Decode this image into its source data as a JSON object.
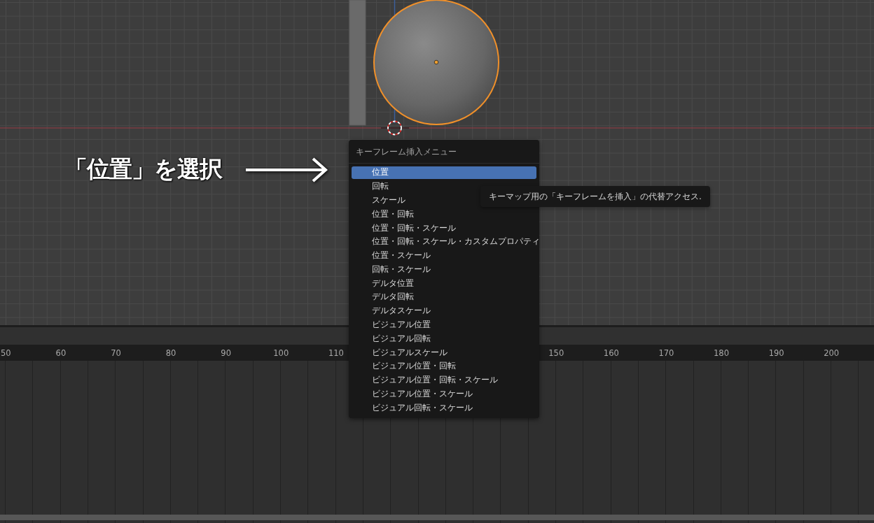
{
  "viewport": {
    "annotation": {
      "text": "「位置」を選択"
    }
  },
  "menu": {
    "title": "キーフレーム挿入メニュー",
    "items": [
      {
        "label": "位置",
        "selected": true
      },
      {
        "label": "回転",
        "selected": false
      },
      {
        "label": "スケール",
        "selected": false
      },
      {
        "label": "位置・回転",
        "selected": false
      },
      {
        "label": "位置・回転・スケール",
        "selected": false
      },
      {
        "label": "位置・回転・スケール・カスタムプロパティ",
        "selected": false
      },
      {
        "label": "位置・スケール",
        "selected": false
      },
      {
        "label": "回転・スケール",
        "selected": false
      },
      {
        "label": "デルタ位置",
        "selected": false
      },
      {
        "label": "デルタ回転",
        "selected": false
      },
      {
        "label": "デルタスケール",
        "selected": false
      },
      {
        "label": "ビジュアル位置",
        "selected": false
      },
      {
        "label": "ビジュアル回転",
        "selected": false
      },
      {
        "label": "ビジュアルスケール",
        "selected": false
      },
      {
        "label": "ビジュアル位置・回転",
        "selected": false
      },
      {
        "label": "ビジュアル位置・回転・スケール",
        "selected": false
      },
      {
        "label": "ビジュアル位置・スケール",
        "selected": false
      },
      {
        "label": "ビジュアル回転・スケール",
        "selected": false
      }
    ]
  },
  "tooltip": {
    "text": "キーマップ用の「キーフレームを挿入」の代替アクセス."
  },
  "timeline": {
    "ruler_labels": [
      "50",
      "60",
      "70",
      "80",
      "90",
      "100",
      "110",
      "150",
      "160",
      "170",
      "180",
      "190",
      "200"
    ]
  }
}
